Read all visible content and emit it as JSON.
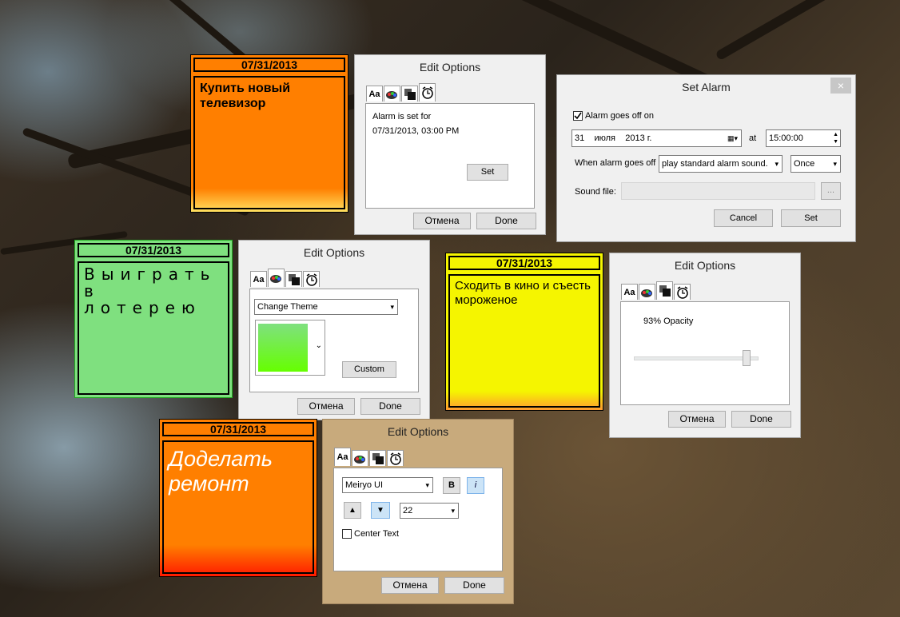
{
  "notes": {
    "tv": {
      "date": "07/31/2013",
      "text": "Купить новый телевизор",
      "color": "#ff7f00"
    },
    "lottery": {
      "date": "07/31/2013",
      "text": "Выиграть в лотерею",
      "color": "#7fe07f"
    },
    "cinema": {
      "date": "07/31/2013",
      "text": "Сходить в кино и съесть мороженое",
      "color": "#f5f500"
    },
    "repair": {
      "date": "07/31/2013",
      "text": "Доделать ремонт",
      "color": "#ff7f00"
    }
  },
  "tab_labels": {
    "font": "Aa"
  },
  "alarm_options": {
    "title": "Edit Options",
    "alarm_set_label": "Alarm is set for",
    "alarm_datetime": "07/31/2013, 03:00 PM",
    "set_label": "Set",
    "cancel_label": "Отмена",
    "done_label": "Done"
  },
  "set_alarm": {
    "title": "Set Alarm",
    "close_glyph": "×",
    "goes_off_label": "Alarm goes off on",
    "date_value": "31    июля    2013 г.",
    "at_label": "at",
    "time_value": "15:00:00",
    "when_label": "When alarm goes off",
    "action_value": "play standard alarm sound.",
    "repeat_value": "Once",
    "sound_label": "Sound file:",
    "browse_label": "...",
    "cancel_label": "Cancel",
    "set_label": "Set"
  },
  "theme_options": {
    "title": "Edit Options",
    "theme_select": "Change Theme",
    "custom_label": "Custom",
    "cancel_label": "Отмена",
    "done_label": "Done"
  },
  "opacity_options": {
    "title": "Edit Options",
    "opacity_label": "93% Opacity",
    "opacity_value": 0.93,
    "cancel_label": "Отмена",
    "done_label": "Done"
  },
  "font_options": {
    "title": "Edit Options",
    "font_name": "Meiryo UI",
    "bold_label": "B",
    "italic_label": "i",
    "up_glyph": "▲",
    "down_glyph": "▼",
    "size_value": "22",
    "center_label": "Center Text",
    "cancel_label": "Отмена",
    "done_label": "Done"
  }
}
